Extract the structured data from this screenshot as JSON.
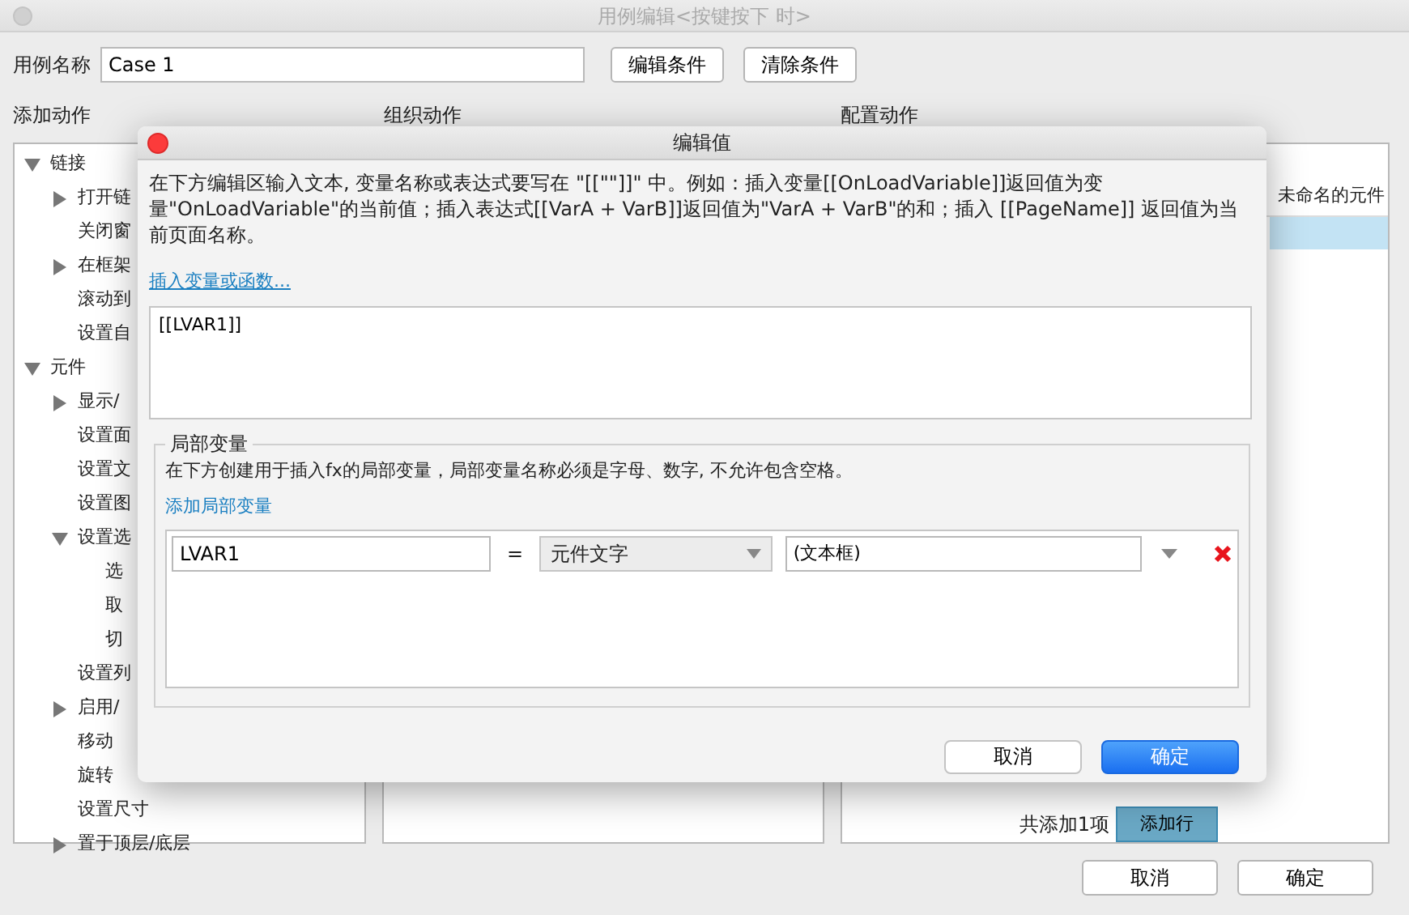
{
  "window": {
    "title": "用例编辑<按键按下 时>"
  },
  "case_name": {
    "label": "用例名称",
    "value": "Case 1"
  },
  "condition_buttons": [
    "编辑条件",
    "清除条件"
  ],
  "sections": [
    "添加动作",
    "组织动作",
    "配置动作"
  ],
  "action_tree": [
    {
      "label": "链接",
      "expanded": true,
      "children": [
        {
          "label": "打开链",
          "expanded": false
        },
        {
          "label": "关闭窗"
        },
        {
          "label": "在框架",
          "expanded": false
        },
        {
          "label": "滚动到"
        },
        {
          "label": "设置自"
        }
      ]
    },
    {
      "label": "元件",
      "expanded": true,
      "children": [
        {
          "label": "显示/",
          "expanded": false
        },
        {
          "label": "设置面"
        },
        {
          "label": "设置文"
        },
        {
          "label": "设置图"
        },
        {
          "label": "设置选",
          "expanded": true,
          "children": [
            {
              "label": "选"
            },
            {
              "label": "取"
            },
            {
              "label": "切"
            }
          ]
        },
        {
          "label": "设置列"
        },
        {
          "label": "启用/",
          "expanded": false
        },
        {
          "label": "移动"
        },
        {
          "label": "旋转"
        },
        {
          "label": "设置尺寸"
        },
        {
          "label": "置于顶层/底层",
          "expanded": false
        }
      ]
    }
  ],
  "configure_panel": {
    "header": "未命名的元件",
    "rows": [
      {
        "selected": true
      }
    ],
    "count_label": "共添加1项",
    "add_button": "添加行"
  },
  "footer_buttons": [
    "取消",
    "确定"
  ],
  "dialog": {
    "title": "编辑值",
    "description": "在下方编辑区输入文本, 变量名称或表达式要写在 \"[[\"\"]]\" 中。例如：插入变量[[OnLoadVariable]]返回值为变量\"OnLoadVariable\"的当前值；插入表达式[[VarA + VarB]]返回值为\"VarA + VarB\"的和；插入 [[PageName]] 返回值为当前页面名称。",
    "insert_link": "插入变量或函数...",
    "value": "[[LVAR1]]",
    "local_vars": {
      "legend": "局部变量",
      "description": "在下方创建用于插入fx的局部变量，局部变量名称必须是字母、数字, 不允许包含空格。",
      "add_link": "添加局部变量",
      "rows": [
        {
          "name": "LVAR1",
          "operator": "=",
          "source": "元件文字",
          "target": "(文本框)"
        }
      ]
    },
    "buttons": [
      {
        "label": "取消",
        "primary": false
      },
      {
        "label": "确定",
        "primary": true
      }
    ]
  }
}
